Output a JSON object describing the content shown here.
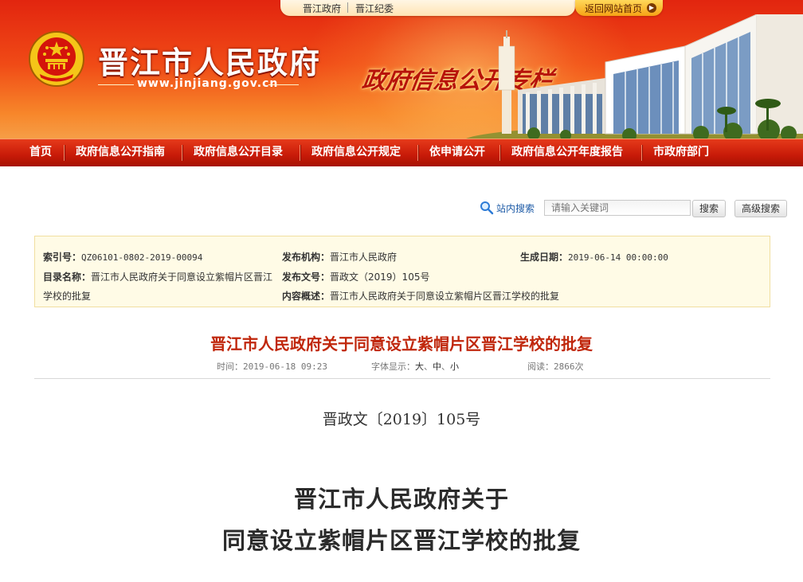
{
  "top_links": {
    "link1": "晋江政府",
    "link2": "晋江纪委",
    "home": "返回网站首页"
  },
  "header": {
    "site_title": "晋江市人民政府",
    "site_url": "www.jinjiang.gov.cn",
    "slogan": "政府信息公开专栏"
  },
  "nav": {
    "items": [
      {
        "label": "首页"
      },
      {
        "label": "政府信息公开指南"
      },
      {
        "label": "政府信息公开目录"
      },
      {
        "label": "政府信息公开规定"
      },
      {
        "label": "依申请公开"
      },
      {
        "label": "政府信息公开年度报告"
      },
      {
        "label": "市政府部门"
      }
    ]
  },
  "search": {
    "label": "站内搜索",
    "placeholder": "请输入关键词",
    "search_button": "搜索",
    "advanced_button": "高级搜索"
  },
  "info": {
    "index_label": "索引号：",
    "index_value": "QZ06101-0802-2019-00094",
    "publisher_label": "发布机构：",
    "publisher_value": "晋江市人民政府",
    "date_label": "生成日期：",
    "date_value": "2019-06-14 00:00:00",
    "catalog_label": "目录名称：",
    "catalog_value_1": "晋江市人民政府关于同意设立紫帽片区晋江",
    "catalog_value_2": "学校的批复",
    "docno_label": "发布文号：",
    "docno_value": "晋政文（2019）105号",
    "summary_label": "内容概述：",
    "summary_value": "晋江市人民政府关于同意设立紫帽片区晋江学校的批复"
  },
  "article": {
    "title": "晋江市人民政府关于同意设立紫帽片区晋江学校的批复",
    "time_label": "时间：",
    "time_value": "2019-06-18 09:23",
    "font_label": "字体显示：",
    "font_large": "大",
    "font_medium": "中",
    "font_small": "小",
    "font_sep": "、",
    "reads_label": "阅读：",
    "reads_value": "2866次"
  },
  "body": {
    "doc_number": "晋政文〔2019〕105号",
    "title_line1": "晋江市人民政府关于",
    "title_line2": "同意设立紫帽片区晋江学校的批复"
  },
  "colors": {
    "banner_red": "#e2250f",
    "nav_red": "#c71a08",
    "title_red": "#c0270c",
    "info_bg": "#fffbe6",
    "link_blue": "#1c5aa6"
  }
}
